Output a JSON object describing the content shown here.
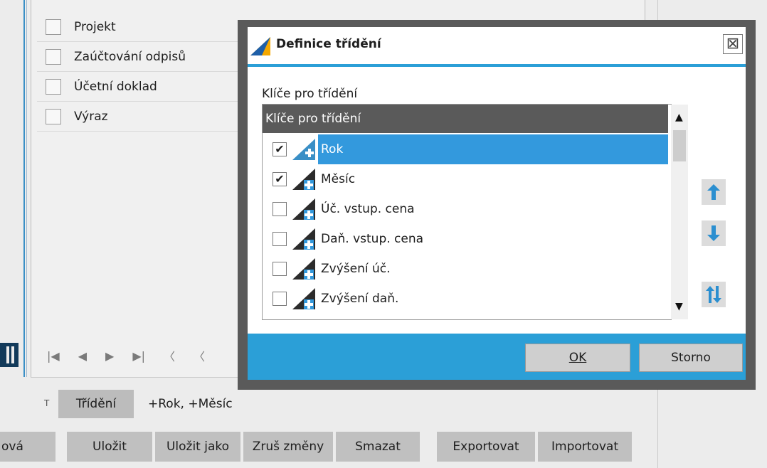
{
  "background": {
    "list_items": [
      "Projekt",
      "Zaúčtování odpisů",
      "Účetní doklad",
      "Výraz"
    ],
    "nav_glyphs": [
      "|◀",
      "◀",
      "▶",
      "▶|",
      "〈",
      "〈"
    ],
    "sort_label": "Třídění",
    "sort_value": "+Rok, +Měsíc",
    "sort_prefix": "T"
  },
  "toolbar": {
    "buttons": [
      "ová",
      "Uložit",
      "Uložit jako",
      "Zruš změny",
      "Smazat",
      "Exportovat",
      "Importovat"
    ]
  },
  "dialog": {
    "title": "Definice třídění",
    "close_glyph": "⊠",
    "group_label": "Klíče pro třídění",
    "column_header": "Klíče pro třídění",
    "rows": [
      {
        "label": "Rok",
        "checked": true,
        "selected": true
      },
      {
        "label": "Měsíc",
        "checked": true,
        "selected": false
      },
      {
        "label": "Úč. vstup. cena",
        "checked": false,
        "selected": false
      },
      {
        "label": "Daň. vstup. cena",
        "checked": false,
        "selected": false
      },
      {
        "label": "Zvýšení úč.",
        "checked": false,
        "selected": false
      },
      {
        "label": "Zvýšení daň.",
        "checked": false,
        "selected": false
      }
    ],
    "ok_label": "OK",
    "cancel_label": "Storno",
    "colors": {
      "accent": "#2b9fd7",
      "selection": "#3399dd",
      "header": "#5a5a5a",
      "frame": "#5a5a5a"
    }
  }
}
